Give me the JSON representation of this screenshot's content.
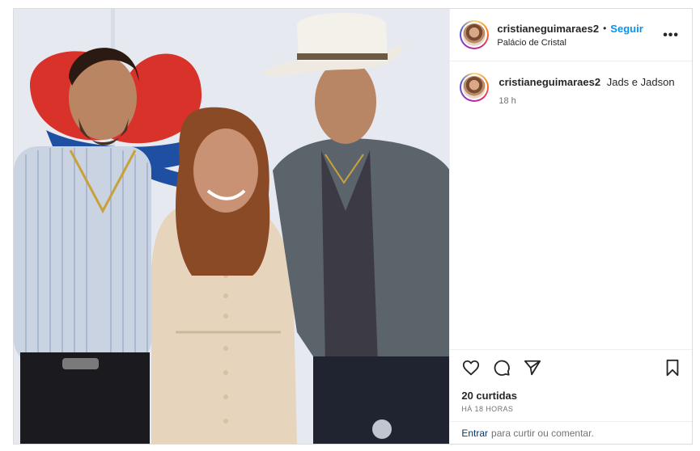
{
  "post": {
    "username": "cristianeguimaraes2",
    "dot": "•",
    "follow_label": "Seguir",
    "location": "Palácio de Cristal",
    "more_label": "•••",
    "caption": {
      "username": "cristianeguimaraes2",
      "text": "Jads e Jadson",
      "time": "18 h"
    },
    "likes": "20 curtidas",
    "time_ago": "HÁ 18 HORAS",
    "comment": {
      "login_label": "Entrar",
      "prompt": "para curtir ou comentar."
    }
  },
  "icons": {
    "like": "heart-icon",
    "comment": "comment-icon",
    "share": "send-icon",
    "save": "bookmark-icon",
    "more": "more-options-icon"
  },
  "colors": {
    "follow_blue": "#0095f6",
    "border": "#dbdbdb",
    "muted_text": "#737373",
    "login_link": "#00376b"
  }
}
